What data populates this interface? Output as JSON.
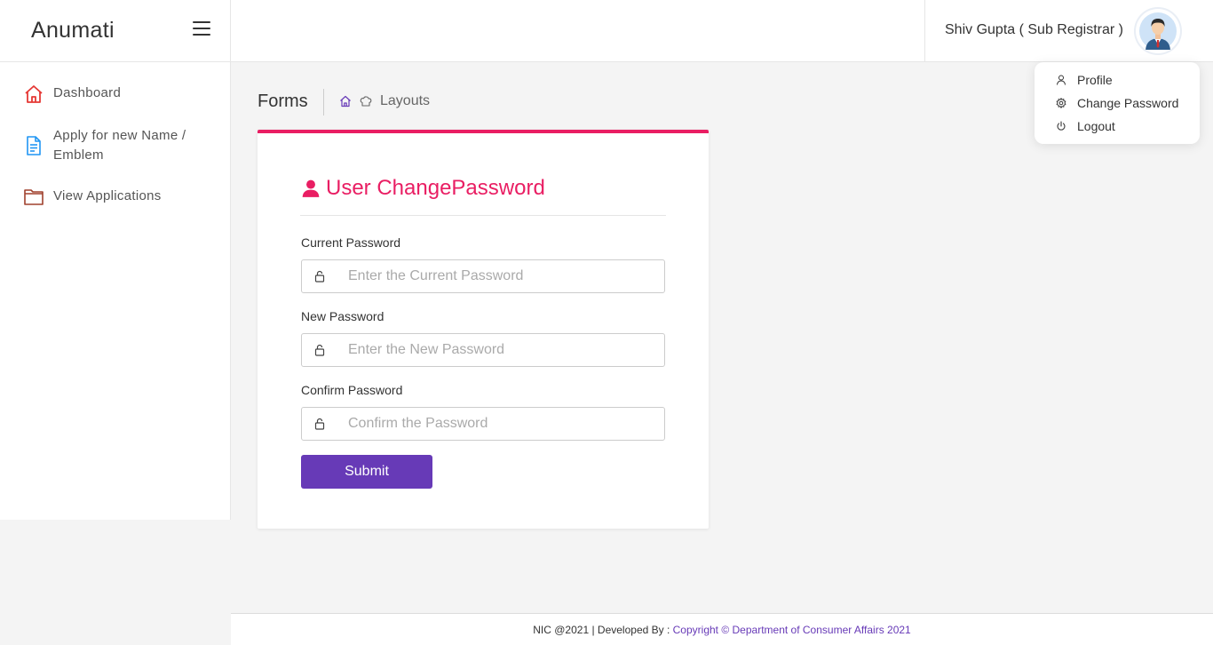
{
  "brand": {
    "name": "Anumati"
  },
  "sidebar": {
    "items": [
      {
        "label": "Dashboard",
        "icon": "home-icon",
        "color": "#e53935"
      },
      {
        "label": "Apply for new Name / Emblem",
        "icon": "document-icon",
        "color": "#2196f3"
      },
      {
        "label": "View Applications",
        "icon": "folder-icon",
        "color": "#a0412d"
      }
    ]
  },
  "header": {
    "username": "Shiv Gupta ( Sub Registrar )"
  },
  "user_menu": {
    "items": [
      {
        "label": "Profile",
        "icon": "user-icon"
      },
      {
        "label": "Change Password",
        "icon": "gear-icon"
      },
      {
        "label": "Logout",
        "icon": "power-icon"
      }
    ]
  },
  "page": {
    "title": "Forms",
    "breadcrumb": "Layouts"
  },
  "form": {
    "title": "User ChangePassword",
    "fields": [
      {
        "label": "Current Password",
        "placeholder": "Enter the Current Password",
        "value": ""
      },
      {
        "label": "New Password",
        "placeholder": "Enter the New Password",
        "value": ""
      },
      {
        "label": "Confirm Password",
        "placeholder": "Confirm the Password",
        "value": ""
      }
    ],
    "submit_label": "Submit"
  },
  "footer": {
    "text": "NIC @2021 | Developed By : ",
    "link": "Copyright © Department of Consumer Affairs 2021"
  },
  "colors": {
    "accent": "#e91e63",
    "primary": "#673ab7"
  }
}
